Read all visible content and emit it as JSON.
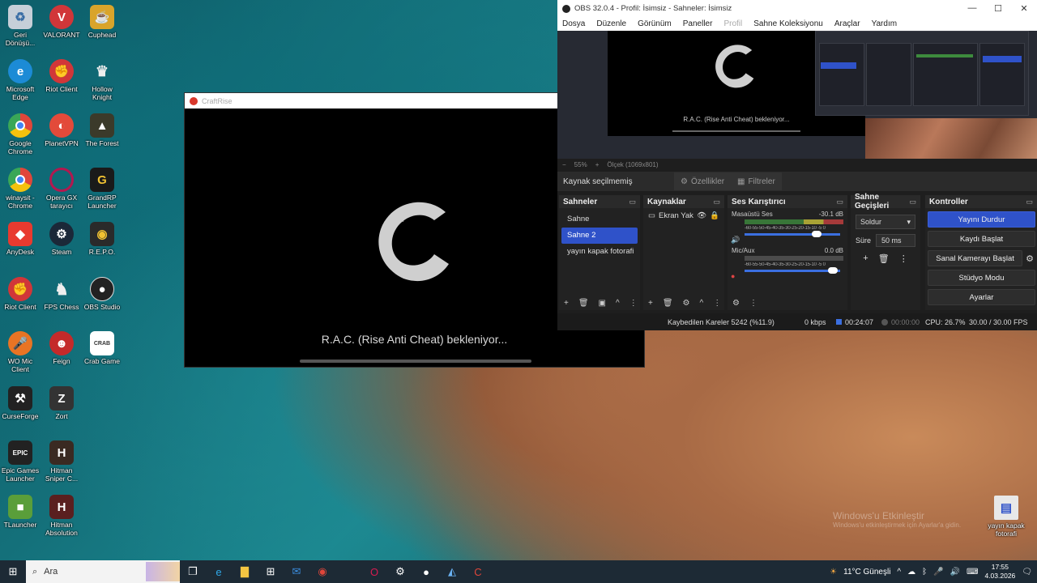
{
  "desktop": {
    "icons_col1": [
      {
        "label": "Geri Dönüşü...",
        "icon": "recycle-bin-icon",
        "color": "#d0d7df"
      },
      {
        "label": "Microsoft Edge",
        "icon": "edge-icon",
        "color": "#1c8bd6"
      },
      {
        "label": "Google Chrome",
        "icon": "chrome-icon",
        "color": "#e0463a"
      },
      {
        "label": "winaysit - Chrome",
        "icon": "chrome-icon",
        "color": "#e0463a"
      },
      {
        "label": "AnyDesk",
        "icon": "anydesk-icon",
        "color": "#e83a2f"
      },
      {
        "label": "Riot Client",
        "icon": "riot-icon",
        "color": "#d13639"
      },
      {
        "label": "WO Mic Client",
        "icon": "microphone-icon",
        "color": "#e87424"
      },
      {
        "label": "CurseForge",
        "icon": "curseforge-icon",
        "color": "#222"
      },
      {
        "label": "Epic Games Launcher",
        "icon": "epic-games-icon",
        "color": "#222"
      },
      {
        "label": "TLauncher",
        "icon": "tlauncher-icon",
        "color": "#5a9e3a"
      }
    ],
    "icons_col2": [
      {
        "label": "VALORANT",
        "icon": "valorant-icon",
        "color": "#d13639"
      },
      {
        "label": "Riot Client",
        "icon": "riot-icon",
        "color": "#d13639"
      },
      {
        "label": "PlanetVPN",
        "icon": "planetvpn-icon",
        "color": "#e34a3a"
      },
      {
        "label": "Opera GX tarayıcı",
        "icon": "opera-gx-icon",
        "color": "#b3184f"
      },
      {
        "label": "Steam",
        "icon": "steam-icon",
        "color": "#1b2838"
      },
      {
        "label": "FPS Chess",
        "icon": "chess-icon",
        "color": "#ddd"
      },
      {
        "label": "Feign",
        "icon": "feign-icon",
        "color": "#c42a2a"
      },
      {
        "label": "Zort",
        "icon": "zort-icon",
        "color": "#333"
      },
      {
        "label": "Hitman Sniper C...",
        "icon": "hitman-icon",
        "color": "#3a2a22"
      },
      {
        "label": "Hitman Absolution",
        "icon": "hitman-icon",
        "color": "#5a1f1f"
      }
    ],
    "icons_col3": [
      {
        "label": "Cuphead",
        "icon": "cuphead-icon",
        "color": "#d9a42b"
      },
      {
        "label": "Hollow Knight",
        "icon": "hollow-knight-icon",
        "color": "#eee"
      },
      {
        "label": "The Forest",
        "icon": "the-forest-icon",
        "color": "#3b3a2a"
      },
      {
        "label": "GrandRP Launcher",
        "icon": "grandrp-icon",
        "color": "#1a1a1a"
      },
      {
        "label": "R.E.P.O.",
        "icon": "repo-icon",
        "color": "#2a2a2a"
      },
      {
        "label": "OBS Studio",
        "icon": "obs-icon",
        "color": "#222"
      },
      {
        "label": "Crab Game",
        "icon": "crab-game-icon",
        "color": "#fff"
      }
    ],
    "right_icon": {
      "label": "yayın kapak fotorafi",
      "icon": "image-file-icon"
    },
    "watermark": {
      "line1": "Windows'u Etkinleştir",
      "line2": "Windows'u etkinleştirmek için Ayarlar'a gidin."
    }
  },
  "craftrise": {
    "title": "CraftRise",
    "waiting_text": "R.A.C. (Rise Anti Cheat) bekleniyor..."
  },
  "obs": {
    "title": "OBS 32.0.4 - Profil: İsimsiz - Sahneler: İsimsiz",
    "menu": [
      "Dosya",
      "Düzenle",
      "Görünüm",
      "Paneller",
      "Profil",
      "Sahne Koleksiyonu",
      "Araçlar",
      "Yardım"
    ],
    "preview_text": "R.A.C. (Rise Anti Cheat) bekleniyor...",
    "zoom": "55%",
    "scale_label": "Ölçek (1069x801)",
    "no_source": "Kaynak seçilmemiş",
    "properties": "Özellikler",
    "filters": "Filtreler",
    "scenes": {
      "title": "Sahneler",
      "items": [
        "Sahne",
        "Sahne 2",
        "yayın kapak fotorafi"
      ],
      "selected": 1
    },
    "sources": {
      "title": "Kaynaklar",
      "items": [
        "Ekran Yak"
      ]
    },
    "mixer": {
      "title": "Ses Karıştırıcı",
      "channels": [
        {
          "name": "Masaüstü Ses",
          "db": "-30.1 dB",
          "ticks": "-60-55-50-45-40-35-30-25-20-15-10 -5 0",
          "level": 0.78
        },
        {
          "name": "Mic/Aux",
          "db": "0.0 dB",
          "ticks": "-60-55-50-45-40-35-30-25-20-15-10 -5 0",
          "level": 0.97
        }
      ]
    },
    "transitions": {
      "title": "Sahne Geçişleri",
      "type": "Soldur",
      "duration_label": "Süre",
      "duration": "50 ms"
    },
    "controls": {
      "title": "Kontroller",
      "stop_stream": "Yayını Durdur",
      "start_record": "Kaydı Başlat",
      "virtual_cam": "Sanal Kamerayı Başlat",
      "studio_mode": "Stüdyo Modu",
      "settings": "Ayarlar"
    },
    "status": {
      "dropped": "Kaybedilen Kareler 5242 (%11.9)",
      "bitrate": "0 kbps",
      "stream_time": "00:24:07",
      "rec_time": "00:00:00",
      "cpu": "CPU: 26.7%",
      "fps": "30.00 / 30.00 FPS"
    }
  },
  "taskbar": {
    "search_placeholder": "Ara",
    "weather": "11°C  Güneşli",
    "time": "17:55",
    "date": "4.03.2026"
  }
}
